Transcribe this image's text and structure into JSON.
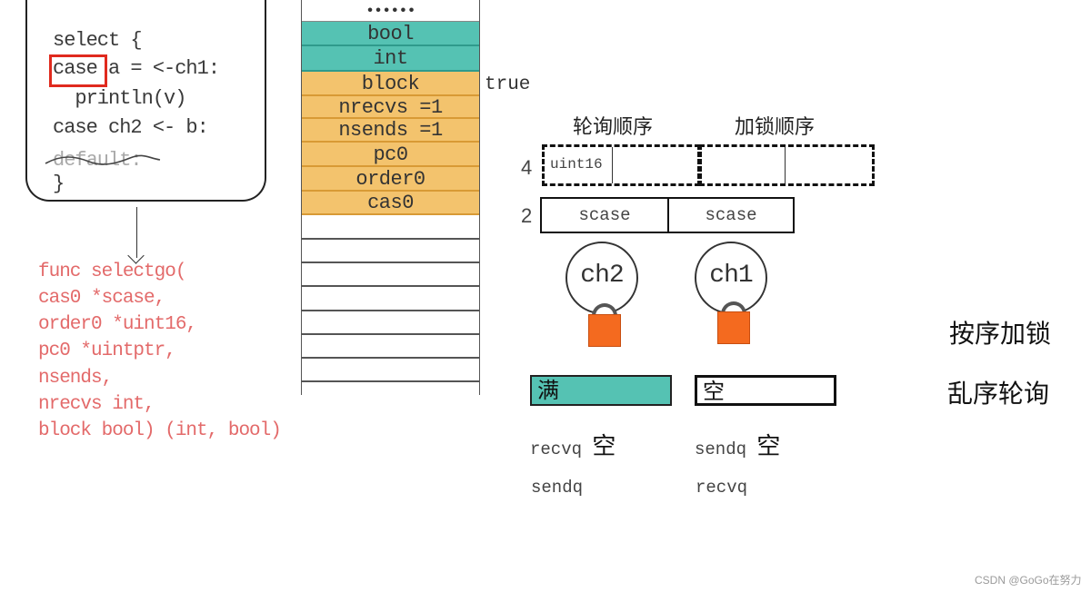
{
  "code_box": {
    "lines": [
      "select {",
      "case a = <-ch1:",
      "  println(v)",
      "case ch2 <- b:",
      "default:",
      "}"
    ],
    "highlighted_keyword": "case",
    "struck_line": "default:"
  },
  "func_signature": {
    "lines": [
      "func selectgo(",
      "cas0 *scase,",
      "order0 *uint16,",
      "pc0 *uintptr,",
      "nsends,",
      "nrecvs int,",
      "block bool) (int, bool)"
    ]
  },
  "stack": {
    "cells": [
      {
        "label": "••••••",
        "kind": "dots"
      },
      {
        "label": "bool",
        "kind": "return"
      },
      {
        "label": "int",
        "kind": "return"
      },
      {
        "label": "block",
        "kind": "arg"
      },
      {
        "label": "nrecvs =1",
        "kind": "arg"
      },
      {
        "label": "nsends =1",
        "kind": "arg"
      },
      {
        "label": "pc0",
        "kind": "arg"
      },
      {
        "label": "order0",
        "kind": "arg"
      },
      {
        "label": "cas0",
        "kind": "arg"
      },
      {
        "label": "",
        "kind": "empty"
      },
      {
        "label": "",
        "kind": "empty"
      },
      {
        "label": "",
        "kind": "empty"
      },
      {
        "label": "",
        "kind": "empty"
      },
      {
        "label": "",
        "kind": "empty"
      },
      {
        "label": "",
        "kind": "empty"
      },
      {
        "label": "",
        "kind": "empty"
      },
      {
        "label": "",
        "kind": "empty"
      }
    ],
    "block_value": "true"
  },
  "order_arrays": {
    "poll_order_heading": "轮询顺序",
    "lock_order_heading": "加锁顺序",
    "order_row_count": "4",
    "order_first_cell_type": "uint16",
    "scase_row_count": "2",
    "scases": [
      "scase",
      "scase"
    ]
  },
  "channels": [
    {
      "name": "ch2",
      "buffer_state": "满",
      "queue1": "recvq",
      "queue1_state": "空",
      "queue2": "sendq"
    },
    {
      "name": "ch1",
      "buffer_state": "空",
      "queue1": "sendq",
      "queue1_state": "空",
      "queue2": "recvq"
    }
  ],
  "colors": {
    "teal": "#55c2b3",
    "orange": "#f3c36d",
    "lock": "#f46a1f",
    "highlight": "#e02a1e",
    "func_text": "#e36a6a"
  },
  "side_notes": [
    "按序加锁",
    "乱序轮询"
  ],
  "watermark": "",
  "credit": "CSDN @GoGo在努力"
}
